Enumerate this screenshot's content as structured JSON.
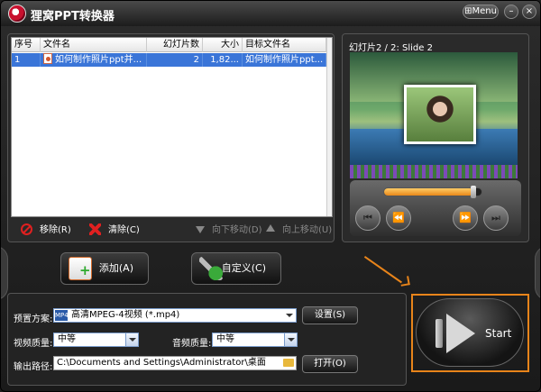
{
  "window": {
    "title": "狸窝PPT转换器",
    "menu_label": "Menu",
    "minimize": "–",
    "close": "×"
  },
  "file_list": {
    "columns": [
      "序号",
      "文件名",
      "幻灯片数",
      "大小",
      "目标文件名"
    ],
    "rows": [
      {
        "index": "1",
        "filename": "如何制作照片ppt并...",
        "slides": "2",
        "size": "1,82...",
        "target": "如何制作照片ppt..."
      }
    ],
    "selected_row": 0
  },
  "list_actions": {
    "remove": "移除(R)",
    "clear": "清除(C)",
    "move_down": "向下移动(D)",
    "move_up": "向上移动(U)"
  },
  "preview": {
    "slide_label": "幻灯片2 / 2: Slide 2",
    "progress": 0.92,
    "buttons": [
      "⏮",
      "⏪",
      "⏩",
      "⏭"
    ]
  },
  "buttons": {
    "add": "添加(A)",
    "customize": "自定义(C)",
    "settings": "设置(S)",
    "open": "打开(O)",
    "start": "Start"
  },
  "settings": {
    "preset_label": "预置方案:",
    "preset_value": "高清MPEG-4视频 (*.mp4)",
    "preset_icon": "MP4",
    "video_quality_label": "视频质量:",
    "video_quality_value": "中等",
    "audio_quality_label": "音频质量:",
    "audio_quality_value": "中等",
    "output_path_label": "输出路径:",
    "output_path_value": "C:\\Documents and Settings\\Administrator\\桌面"
  },
  "colors": {
    "selection": "#3a75d8",
    "highlight": "#e8841a",
    "progress": "#e8881a"
  },
  "icons": {
    "remove": "no-entry-icon",
    "clear": "clear-x-icon",
    "move_down": "arrow-down-icon",
    "move_up": "arrow-up-icon",
    "add": "add-file-icon",
    "customize": "tools-icon",
    "folder": "folder-icon"
  }
}
